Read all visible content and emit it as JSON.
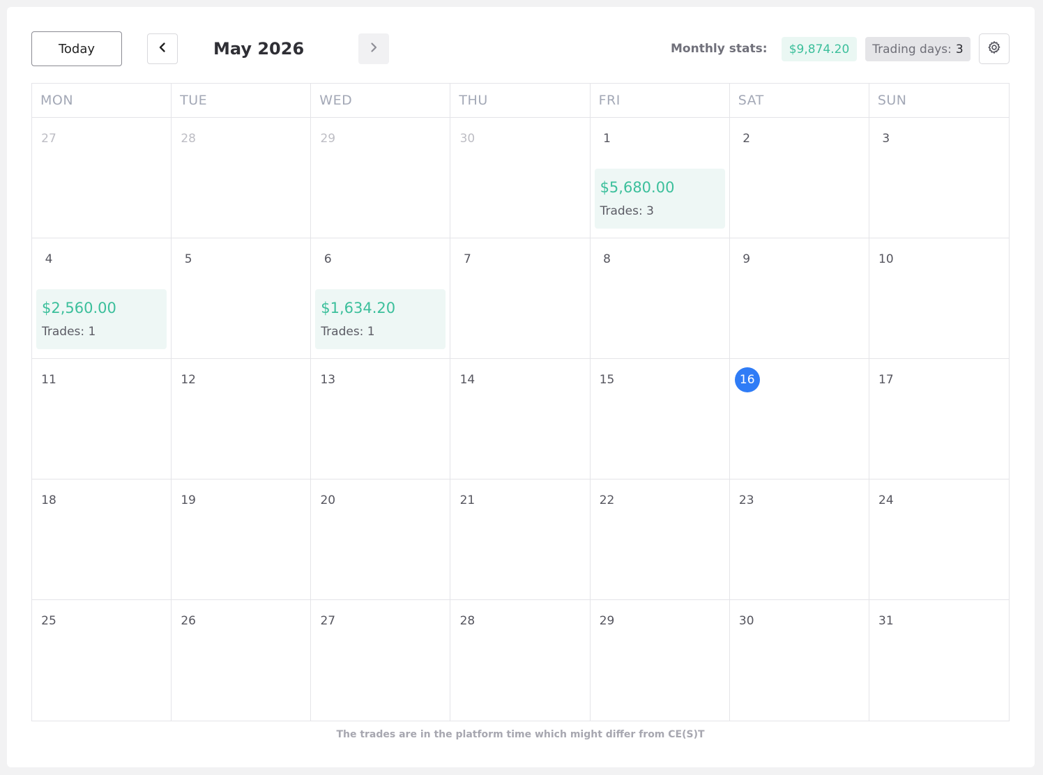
{
  "toolbar": {
    "today_label": "Today",
    "month_title": "May 2026",
    "prev_icon": "chevron-left-icon",
    "next_icon": "chevron-right-icon",
    "settings_icon": "gear-icon",
    "monthly_stats_label": "Monthly stats:",
    "monthly_stats_value": "$9,874.20",
    "trading_days_label": "Trading days:",
    "trading_days_value": "3"
  },
  "weekdays": [
    "MON",
    "TUE",
    "WED",
    "THU",
    "FRI",
    "SAT",
    "SUN"
  ],
  "days": [
    {
      "num": "27",
      "outside": true
    },
    {
      "num": "28",
      "outside": true
    },
    {
      "num": "29",
      "outside": true
    },
    {
      "num": "30",
      "outside": true
    },
    {
      "num": "1",
      "trade": {
        "amount": "$5,680.00",
        "count": "Trades: 3"
      }
    },
    {
      "num": "2"
    },
    {
      "num": "3"
    },
    {
      "num": "4",
      "trade": {
        "amount": "$2,560.00",
        "count": "Trades: 1"
      }
    },
    {
      "num": "5"
    },
    {
      "num": "6",
      "trade": {
        "amount": "$1,634.20",
        "count": "Trades: 1"
      }
    },
    {
      "num": "7"
    },
    {
      "num": "8"
    },
    {
      "num": "9"
    },
    {
      "num": "10"
    },
    {
      "num": "11"
    },
    {
      "num": "12"
    },
    {
      "num": "13"
    },
    {
      "num": "14"
    },
    {
      "num": "15"
    },
    {
      "num": "16",
      "today": true
    },
    {
      "num": "17"
    },
    {
      "num": "18"
    },
    {
      "num": "19"
    },
    {
      "num": "20"
    },
    {
      "num": "21"
    },
    {
      "num": "22"
    },
    {
      "num": "23"
    },
    {
      "num": "24"
    },
    {
      "num": "25"
    },
    {
      "num": "26"
    },
    {
      "num": "27"
    },
    {
      "num": "28"
    },
    {
      "num": "29"
    },
    {
      "num": "30"
    },
    {
      "num": "31"
    }
  ],
  "colors": {
    "accent_green": "#3bbf9b",
    "today_blue": "#2f7cf6",
    "trade_bg": "#eef7f5"
  },
  "footer_note": "The trades are in the platform time which might differ from CE(S)T"
}
